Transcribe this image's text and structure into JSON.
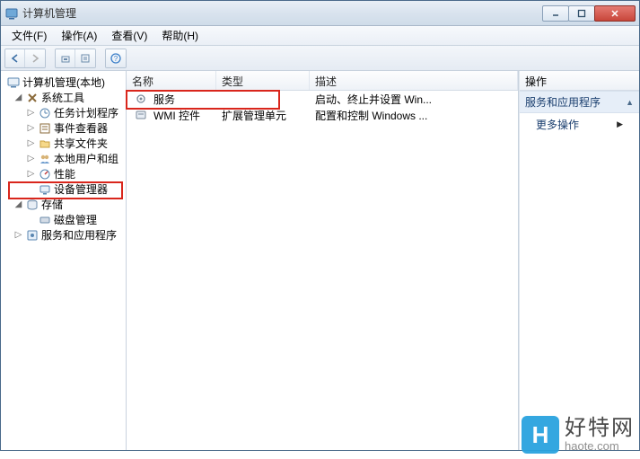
{
  "window": {
    "title": "计算机管理"
  },
  "menu": {
    "file": "文件(F)",
    "action": "操作(A)",
    "view": "查看(V)",
    "help": "帮助(H)"
  },
  "tree": {
    "root": "计算机管理(本地)",
    "system_tools": "系统工具",
    "task_scheduler": "任务计划程序",
    "event_viewer": "事件查看器",
    "shared_folders": "共享文件夹",
    "local_users": "本地用户和组",
    "performance": "性能",
    "device_manager": "设备管理器",
    "storage": "存储",
    "disk_mgmt": "磁盘管理",
    "services_apps": "服务和应用程序"
  },
  "list": {
    "headers": {
      "name": "名称",
      "type": "类型",
      "desc": "描述"
    },
    "rows": [
      {
        "name": "服务",
        "type": "",
        "desc": "启动、终止并设置 Win..."
      },
      {
        "name": "WMI 控件",
        "type": "扩展管理单元",
        "desc": "配置和控制 Windows ..."
      }
    ]
  },
  "actions": {
    "header": "操作",
    "title": "服务和应用程序",
    "more": "更多操作"
  },
  "watermark": {
    "cn": "好特网",
    "en": "haote.com",
    "letter": "H"
  }
}
